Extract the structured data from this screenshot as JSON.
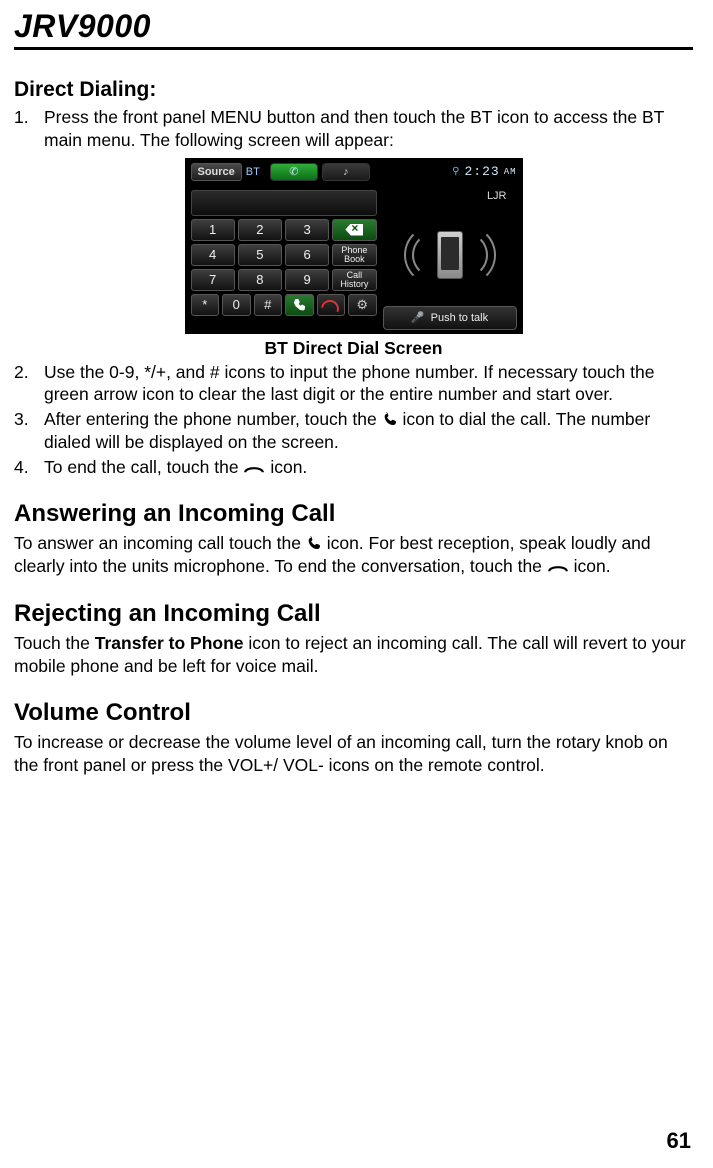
{
  "header": {
    "product": "JRV9000"
  },
  "direct_dialing": {
    "heading": "Direct Dialing:",
    "items": [
      "Press the front panel MENU button and then touch the BT icon to access the BT main menu. The following screen will appear:",
      "Use the 0-9, */+, and # icons to input the phone number. If necessary touch the green arrow icon to clear the last digit or the entire number and start over.",
      "After entering the phone number, touch the ",
      " icon to dial the call. The number dialed will be displayed on the screen.",
      "To end the call, touch the ",
      " icon."
    ],
    "caption": "BT Direct Dial Screen"
  },
  "screenshot": {
    "source_label": "Source",
    "bt_label": "BT",
    "clock": "2:23",
    "clock_ampm": "AM",
    "device": "LJR",
    "keys": {
      "r1": [
        "1",
        "2",
        "3"
      ],
      "r2": [
        "4",
        "5",
        "6"
      ],
      "r3": [
        "7",
        "8",
        "9"
      ],
      "r4": [
        "*",
        "0",
        "#"
      ],
      "phone_book": "Phone\nBook",
      "call_history": "Call\nHistory"
    },
    "push_to_talk": "Push to talk"
  },
  "answering": {
    "heading": "Answering an Incoming Call",
    "body_a": "To answer an incoming call touch the ",
    "body_b": " icon. For best reception, speak loudly and clearly into the units microphone. To end the conversation, touch the ",
    "body_c": " icon."
  },
  "rejecting": {
    "heading": "Rejecting an Incoming Call",
    "body_a": "Touch the ",
    "bold": "Transfer to Phone",
    "body_b": " icon to reject an incoming call. The call will revert to your mobile phone and be left for voice mail."
  },
  "volume": {
    "heading": "Volume Control",
    "body": "To increase or decrease the volume level of an incoming call, turn the rotary knob on the front panel or press the VOL+/ VOL- icons on the remote control."
  },
  "page_number": "61"
}
